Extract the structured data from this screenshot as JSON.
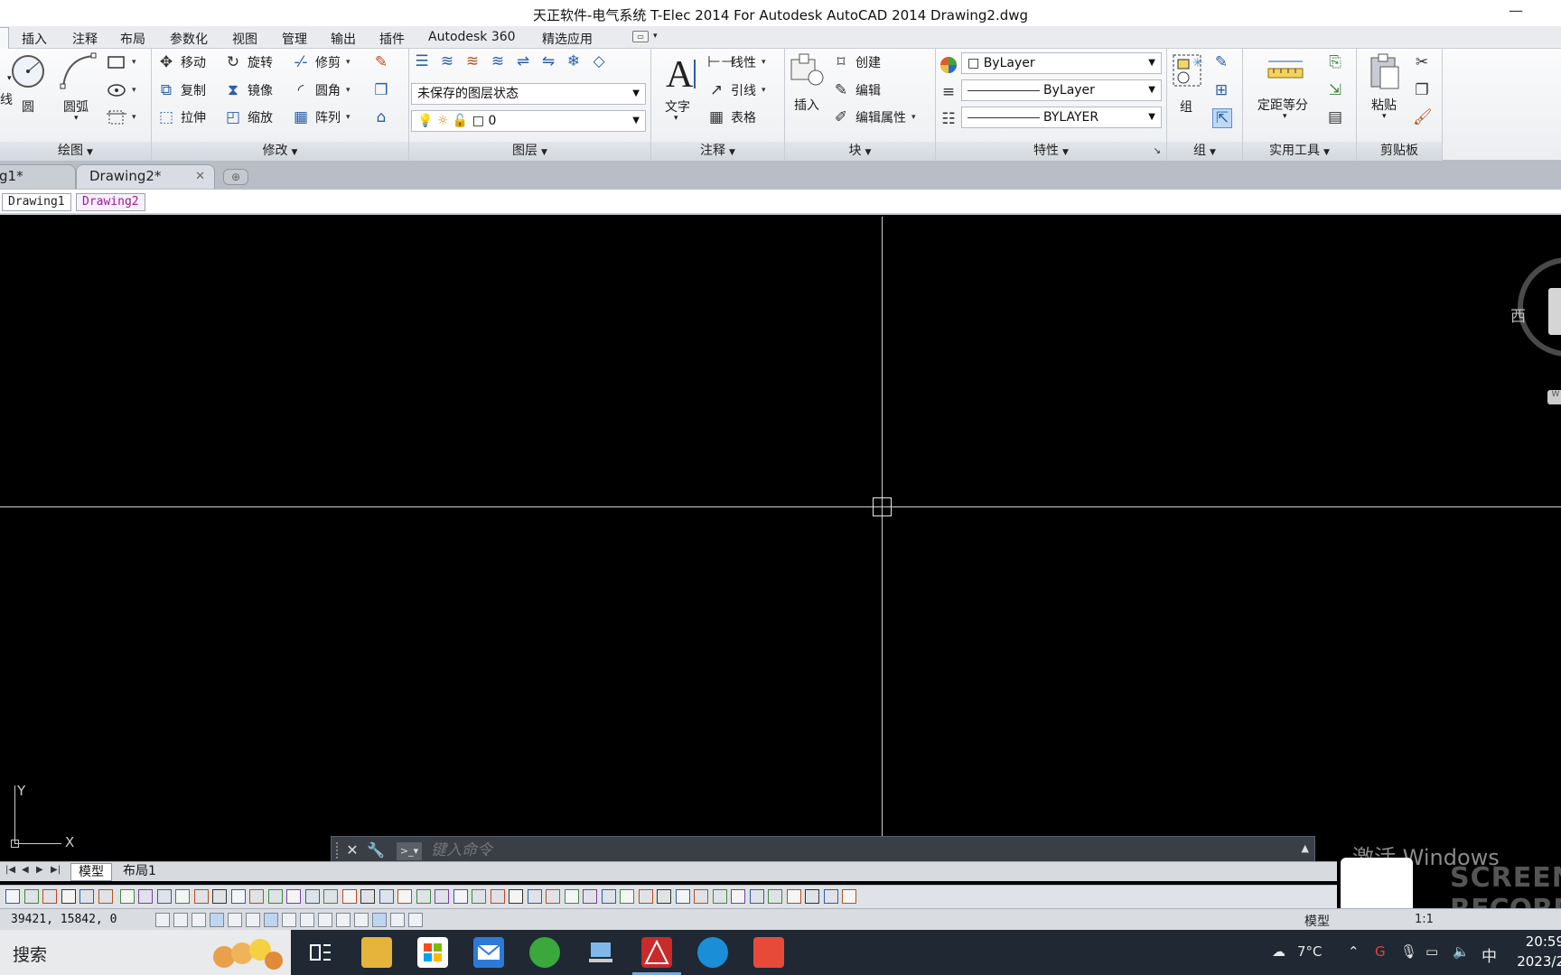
{
  "window": {
    "title": "天正软件-电气系统 T-Elec 2014  For Autodesk AutoCAD 2014    Drawing2.dwg",
    "minimize_icon": "minimize-icon"
  },
  "ribbon_tabs": [
    "插入",
    "注释",
    "布局",
    "参数化",
    "视图",
    "管理",
    "输出",
    "插件",
    "Autodesk 360",
    "精选应用"
  ],
  "ribbon": {
    "draw": {
      "title": "绘图",
      "circle": "圆",
      "arc": "圆弧",
      "partial": "线"
    },
    "modify": {
      "title": "修改",
      "move": "移动",
      "rotate": "旋转",
      "trim": "修剪",
      "copy": "复制",
      "mirror": "镜像",
      "fillet": "圆角",
      "stretch": "拉伸",
      "scale": "缩放",
      "array": "阵列"
    },
    "layers": {
      "title": "图层",
      "state": "未保存的图层状态",
      "current_layer": "0"
    },
    "annotation": {
      "title": "注释",
      "text": "文字",
      "linear": "线性",
      "leader": "引线",
      "table": "表格"
    },
    "block": {
      "title": "块",
      "insert": "插入",
      "create": "创建",
      "edit": "编辑",
      "edit_attr": "编辑属性"
    },
    "properties": {
      "title": "特性",
      "color": "ByLayer",
      "linetype": "ByLayer",
      "lineweight": "BYLAYER"
    },
    "groups": {
      "title": "组",
      "group": "组"
    },
    "utilities": {
      "title": "实用工具",
      "measure": "定距等分"
    },
    "clipboard": {
      "title": "剪贴板",
      "paste": "粘贴"
    }
  },
  "doc_tabs": [
    {
      "label": "g1*"
    },
    {
      "label": "Drawing2*"
    }
  ],
  "layout_tabs": [
    "Drawing1",
    "Drawing2"
  ],
  "canvas": {
    "viewcube_label": "西",
    "viewcube_w": "W",
    "ucs_x": "X",
    "ucs_y": "Y"
  },
  "command": {
    "placeholder": "键入命令"
  },
  "watermark": {
    "line1": "激活 Windows",
    "rec1": "SCREEN",
    "rec2": "RECORD"
  },
  "model_tabs": [
    "模型",
    "布局1"
  ],
  "status": {
    "coords": "39421, 15842, 0",
    "model": "模型",
    "scale": "1:1"
  },
  "taskbar": {
    "search": "搜索",
    "weather": "7°C",
    "ime": "中",
    "time": "20:59",
    "date": "2023/2"
  }
}
